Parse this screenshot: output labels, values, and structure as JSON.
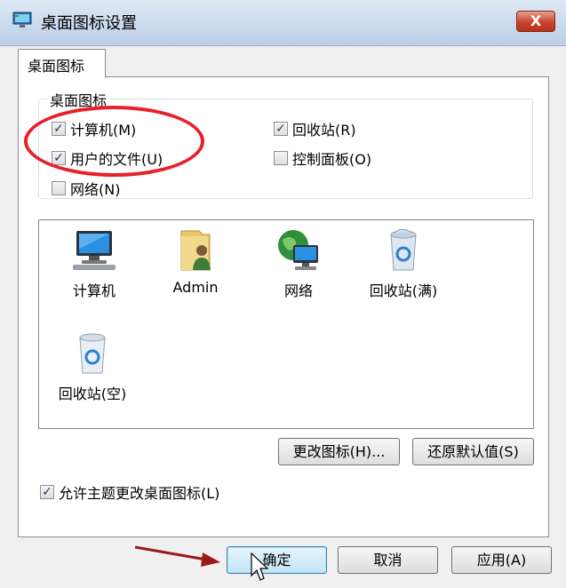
{
  "window": {
    "title": "桌面图标设置",
    "close_label": "X"
  },
  "tab": {
    "label": "桌面图标"
  },
  "group": {
    "title": "桌面图标",
    "checkboxes": [
      {
        "label": "计算机(M)",
        "checked": true
      },
      {
        "label": "回收站(R)",
        "checked": true
      },
      {
        "label": "用户的文件(U)",
        "checked": true
      },
      {
        "label": "控制面板(O)",
        "checked": false
      },
      {
        "label": "网络(N)",
        "checked": false
      }
    ]
  },
  "icons": [
    {
      "label": "计算机",
      "icon": "computer-icon"
    },
    {
      "label": "Admin",
      "icon": "user-folder-icon"
    },
    {
      "label": "网络",
      "icon": "network-icon"
    },
    {
      "label": "回收站(满)",
      "icon": "recycle-bin-full-icon"
    },
    {
      "label": "回收站(空)",
      "icon": "recycle-bin-empty-icon"
    }
  ],
  "buttons": {
    "change_icon": "更改图标(H)...",
    "restore_default": "还原默认值(S)",
    "ok": "确定",
    "cancel": "取消",
    "apply": "应用(A)"
  },
  "allow_themes": {
    "label": "允许主题更改桌面图标(L)",
    "checked": true
  },
  "annotation_color": "#e8202a",
  "check_mark": "✓"
}
